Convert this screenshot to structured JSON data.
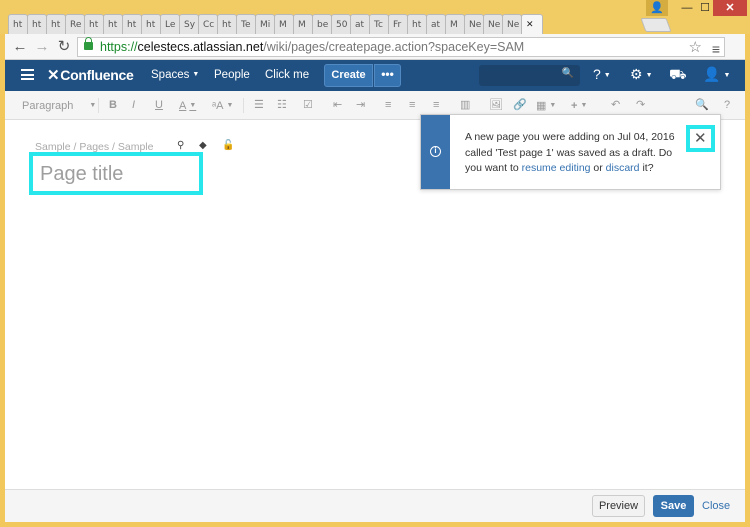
{
  "browser": {
    "tabs": [
      "ht",
      "ht",
      "ht",
      "Re",
      "ht",
      "ht",
      "ht",
      "ht",
      "Le",
      "Sy",
      "Cc",
      "ht",
      "Te",
      "Mi",
      "M",
      "M",
      "be",
      "50",
      "at",
      "Tc",
      "Fr",
      "ht",
      "at",
      "M",
      "Ne",
      "Ne",
      "Ne"
    ],
    "active_tab_close": "✕",
    "url_scheme": "https://",
    "url_host": "celestecs.atlassian.net",
    "url_path": "/wiki/pages/createpage.action?spaceKey=SAM"
  },
  "header": {
    "logo": "Confluence",
    "nav": [
      "Spaces",
      "People",
      "Click me"
    ],
    "create_label": "Create",
    "more_label": "•••",
    "accent": "#205081"
  },
  "toolbar": {
    "paragraph_label": "Paragraph"
  },
  "page": {
    "breadcrumbs": "Sample  /  Pages  /  Sample",
    "title_placeholder": "Page title"
  },
  "notice": {
    "text_before": "A new page you were adding on Jul 04, 2016 called 'Test page 1' was saved as a draft. Do you want to ",
    "resume_link": "resume editing",
    "or_text": " or ",
    "discard_link": "discard",
    "text_after": " it?"
  },
  "footer": {
    "preview_label": "Preview",
    "save_label": "Save",
    "close_label": "Close"
  },
  "icons": {
    "search": "search-icon",
    "help": "help-icon",
    "settings": "gear-icon",
    "notifications": "inbox-icon",
    "user": "user-avatar-icon"
  }
}
